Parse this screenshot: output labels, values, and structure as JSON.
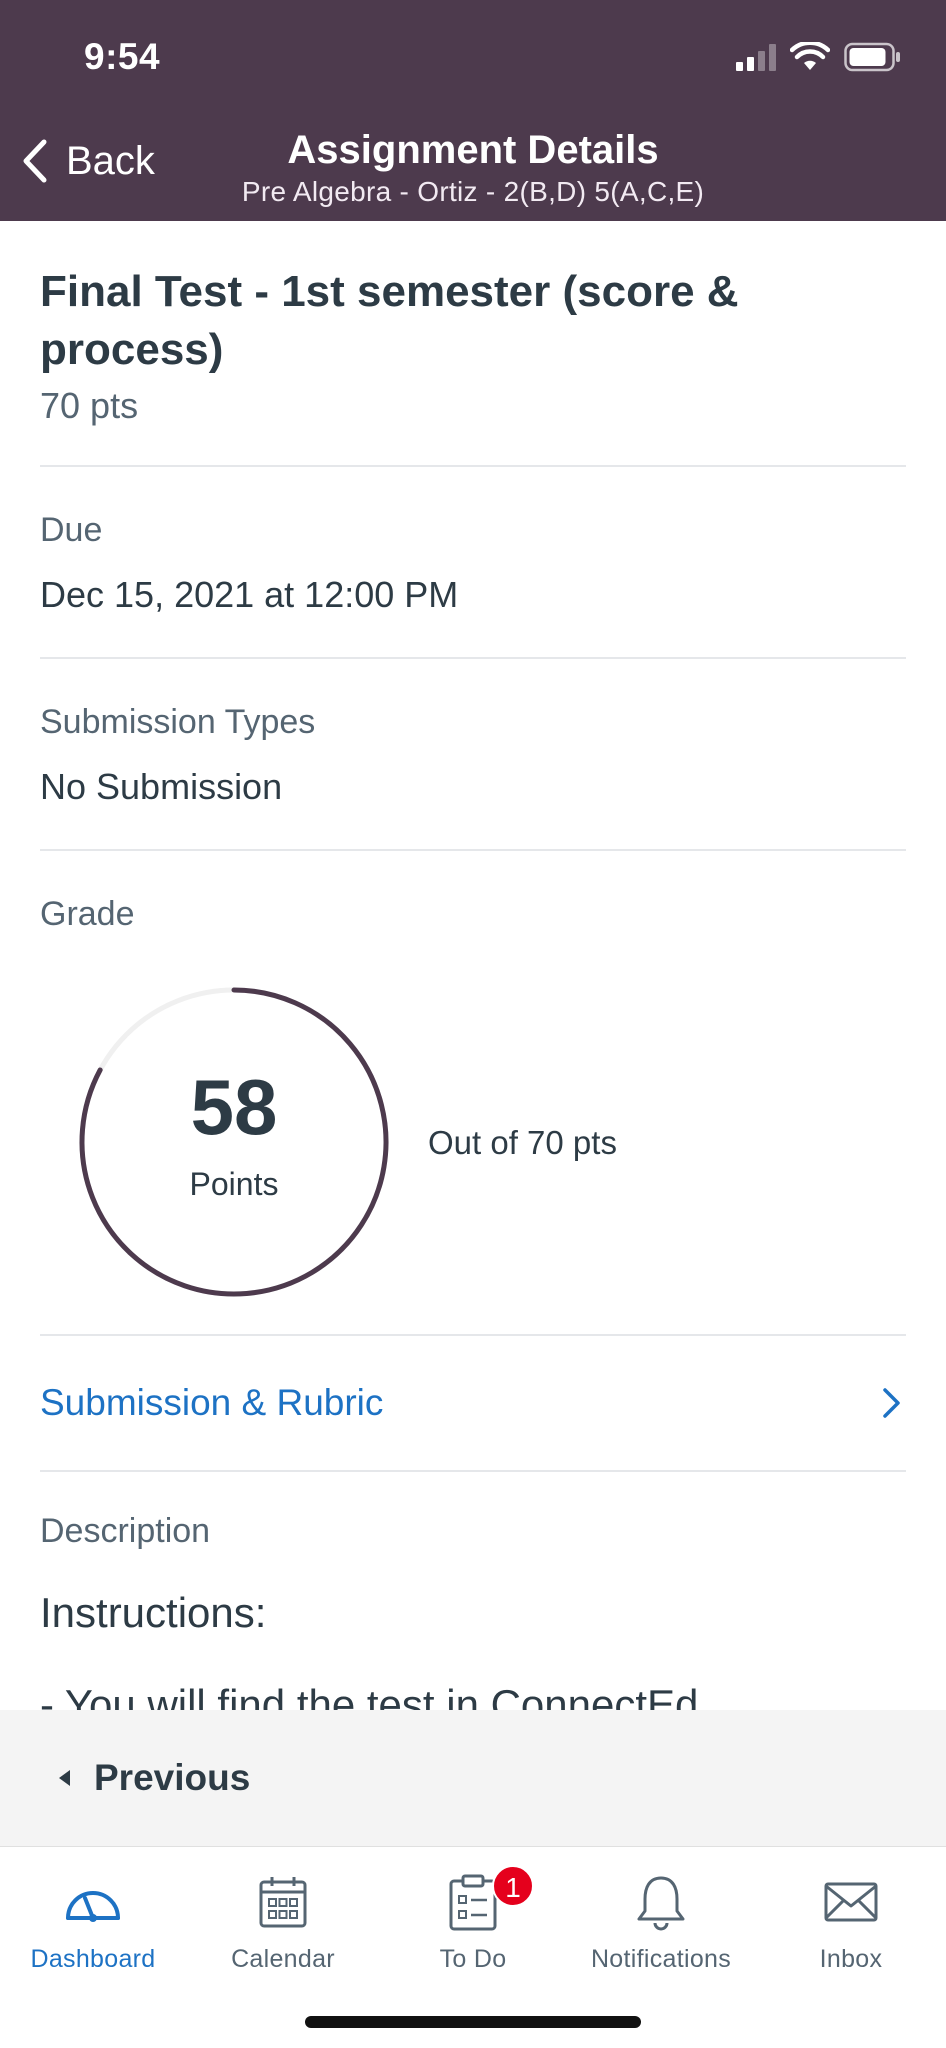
{
  "status_bar": {
    "time": "9:54"
  },
  "header": {
    "back_label": "Back",
    "title": "Assignment Details",
    "subtitle": "Pre Algebra - Ortiz - 2(B,D) 5(A,C,E)"
  },
  "assignment": {
    "title": "Final Test - 1st semester (score & process)",
    "points": "70 pts"
  },
  "due": {
    "label": "Due",
    "value": "Dec 15, 2021 at 12:00 PM"
  },
  "submission_types": {
    "label": "Submission Types",
    "value": "No Submission"
  },
  "grade": {
    "label": "Grade",
    "score": "58",
    "unit": "Points",
    "out_of": "Out of 70 pts",
    "fraction": 0.8286,
    "ring_color": "#4d3a4d",
    "track_color": "#f0f0f0"
  },
  "submission_rubric": {
    "label": "Submission & Rubric"
  },
  "description": {
    "label": "Description",
    "lines": [
      "Instructions:",
      "- You will find the test in ConnectEd."
    ]
  },
  "previous": {
    "label": "Previous"
  },
  "tabs": [
    {
      "label": "Dashboard",
      "icon": "dashboard-icon",
      "active": true
    },
    {
      "label": "Calendar",
      "icon": "calendar-icon",
      "active": false
    },
    {
      "label": "To Do",
      "icon": "todo-icon",
      "active": false,
      "badge": "1"
    },
    {
      "label": "Notifications",
      "icon": "bell-icon",
      "active": false
    },
    {
      "label": "Inbox",
      "icon": "inbox-icon",
      "active": false
    }
  ],
  "colors": {
    "header_bg": "#4d3a4d",
    "link": "#1d72c4",
    "badge": "#e5001c"
  }
}
